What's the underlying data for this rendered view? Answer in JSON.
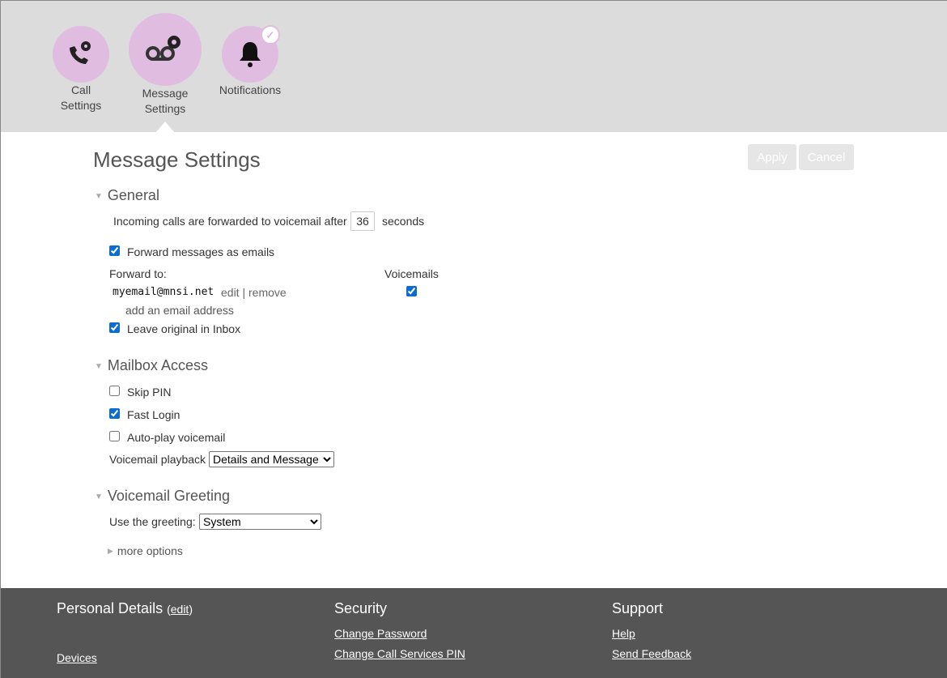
{
  "nav": [
    {
      "line1": "Call",
      "line2": "Settings",
      "icon": "phone-gear-icon"
    },
    {
      "line1": "Message",
      "line2": "Settings",
      "icon": "voicemail-gear-icon",
      "active": true
    },
    {
      "line1": "Notifications",
      "icon": "bell-icon",
      "badge": "✓"
    }
  ],
  "page": {
    "title": "Message Settings",
    "apply": "Apply",
    "cancel": "Cancel"
  },
  "general": {
    "heading": "General",
    "forward_prefix": "Incoming calls are forwarded to voicemail after",
    "forward_seconds": "36",
    "forward_suffix": "seconds",
    "forward_emails_label": "Forward messages as emails",
    "forward_emails_checked": true,
    "forward_to_label": "Forward to:",
    "voicemails_label": "Voicemails",
    "email": "myemail@mnsi.net",
    "edit": "edit",
    "sep": "|",
    "remove": "remove",
    "email_voicemails_checked": true,
    "add_email": "add an email address",
    "leave_original_label": "Leave original in Inbox",
    "leave_original_checked": true
  },
  "mailbox": {
    "heading": "Mailbox Access",
    "skip_pin": "Skip PIN",
    "skip_pin_checked": false,
    "fast_login": "Fast Login",
    "fast_login_checked": true,
    "autoplay": "Auto-play voicemail",
    "autoplay_checked": false,
    "playback_label": "Voicemail playback",
    "playback_value": "Details and Message"
  },
  "greeting": {
    "heading": "Voicemail Greeting",
    "use_label": "Use the greeting:",
    "value": "System",
    "more": "more options"
  },
  "footer": {
    "personal": "Personal Details",
    "open": "(",
    "edit": "edit",
    "close": ")",
    "devices": "Devices",
    "security": "Security",
    "change_password": "Change Password",
    "change_pin": "Change Call Services PIN",
    "support": "Support",
    "help": "Help",
    "feedback": "Send Feedback"
  },
  "colors": {
    "accent": "#e0bde0",
    "header_bg": "#dcdcdc",
    "footer_bg": "#555555"
  }
}
